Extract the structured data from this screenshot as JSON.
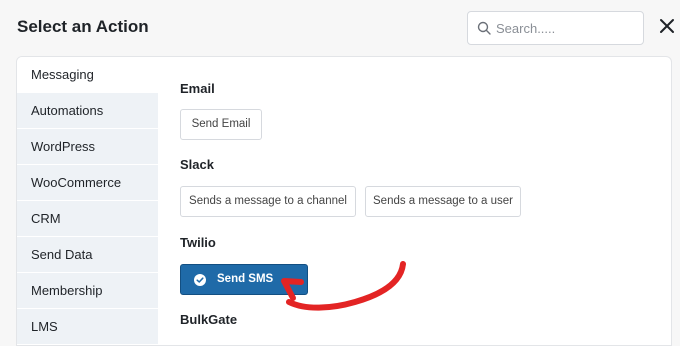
{
  "dialog": {
    "title": "Select an Action"
  },
  "search": {
    "placeholder": "Search....."
  },
  "sidebar": {
    "items": [
      {
        "label": "Messaging",
        "active": true
      },
      {
        "label": "Automations"
      },
      {
        "label": "WordPress"
      },
      {
        "label": "WooCommerce"
      },
      {
        "label": "CRM"
      },
      {
        "label": "Send Data"
      },
      {
        "label": "Membership"
      },
      {
        "label": "LMS"
      }
    ]
  },
  "groups": [
    {
      "name": "Email",
      "actions": [
        "Send Email"
      ]
    },
    {
      "name": "Slack",
      "actions": [
        "Sends a message to a channel",
        "Sends a message to a user"
      ]
    },
    {
      "name": "Twilio",
      "actions": [
        "Send SMS"
      ]
    },
    {
      "name": "BulkGate"
    }
  ],
  "colors": {
    "primary": "#1f6aa8",
    "annotation_arrow": "#e32424"
  }
}
